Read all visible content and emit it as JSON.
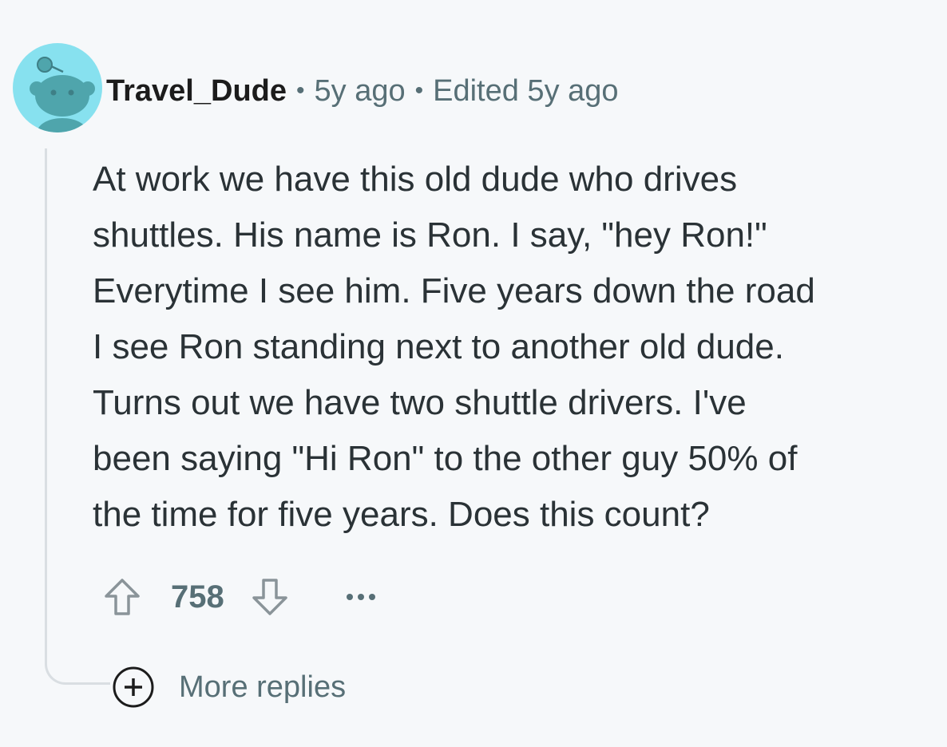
{
  "comment": {
    "author": "Travel_Dude",
    "separator": "•",
    "age": "5y ago",
    "edited": "Edited 5y ago",
    "body_lines": [
      "At work we have this old dude who drives",
      "shuttles. His name is Ron. I say, \"hey Ron!\"",
      "Everytime I see him. Five years down the road",
      "I see Ron standing next to another old dude.",
      "Turns out we have two shuttle drivers. I've",
      "been saying \"Hi Ron\" to the other guy 50% of",
      "the time for five years. Does this count?"
    ],
    "score": "758",
    "more_replies_label": "More replies",
    "avatar_icon": "snoo-avatar-icon",
    "upvote_icon": "arrow-up-outline-icon",
    "downvote_icon": "arrow-down-outline-icon",
    "overflow_icon": "ellipsis-icon",
    "expand_icon": "plus-circle-icon"
  },
  "colors": {
    "background": "#f6f8fa",
    "avatar_background": "#87e1ef",
    "avatar_figure": "#4fa5ac",
    "author_text": "#1c1c1c",
    "meta_text": "#576f76",
    "body_text": "#2a3236",
    "thread_line": "#d9dee2"
  }
}
